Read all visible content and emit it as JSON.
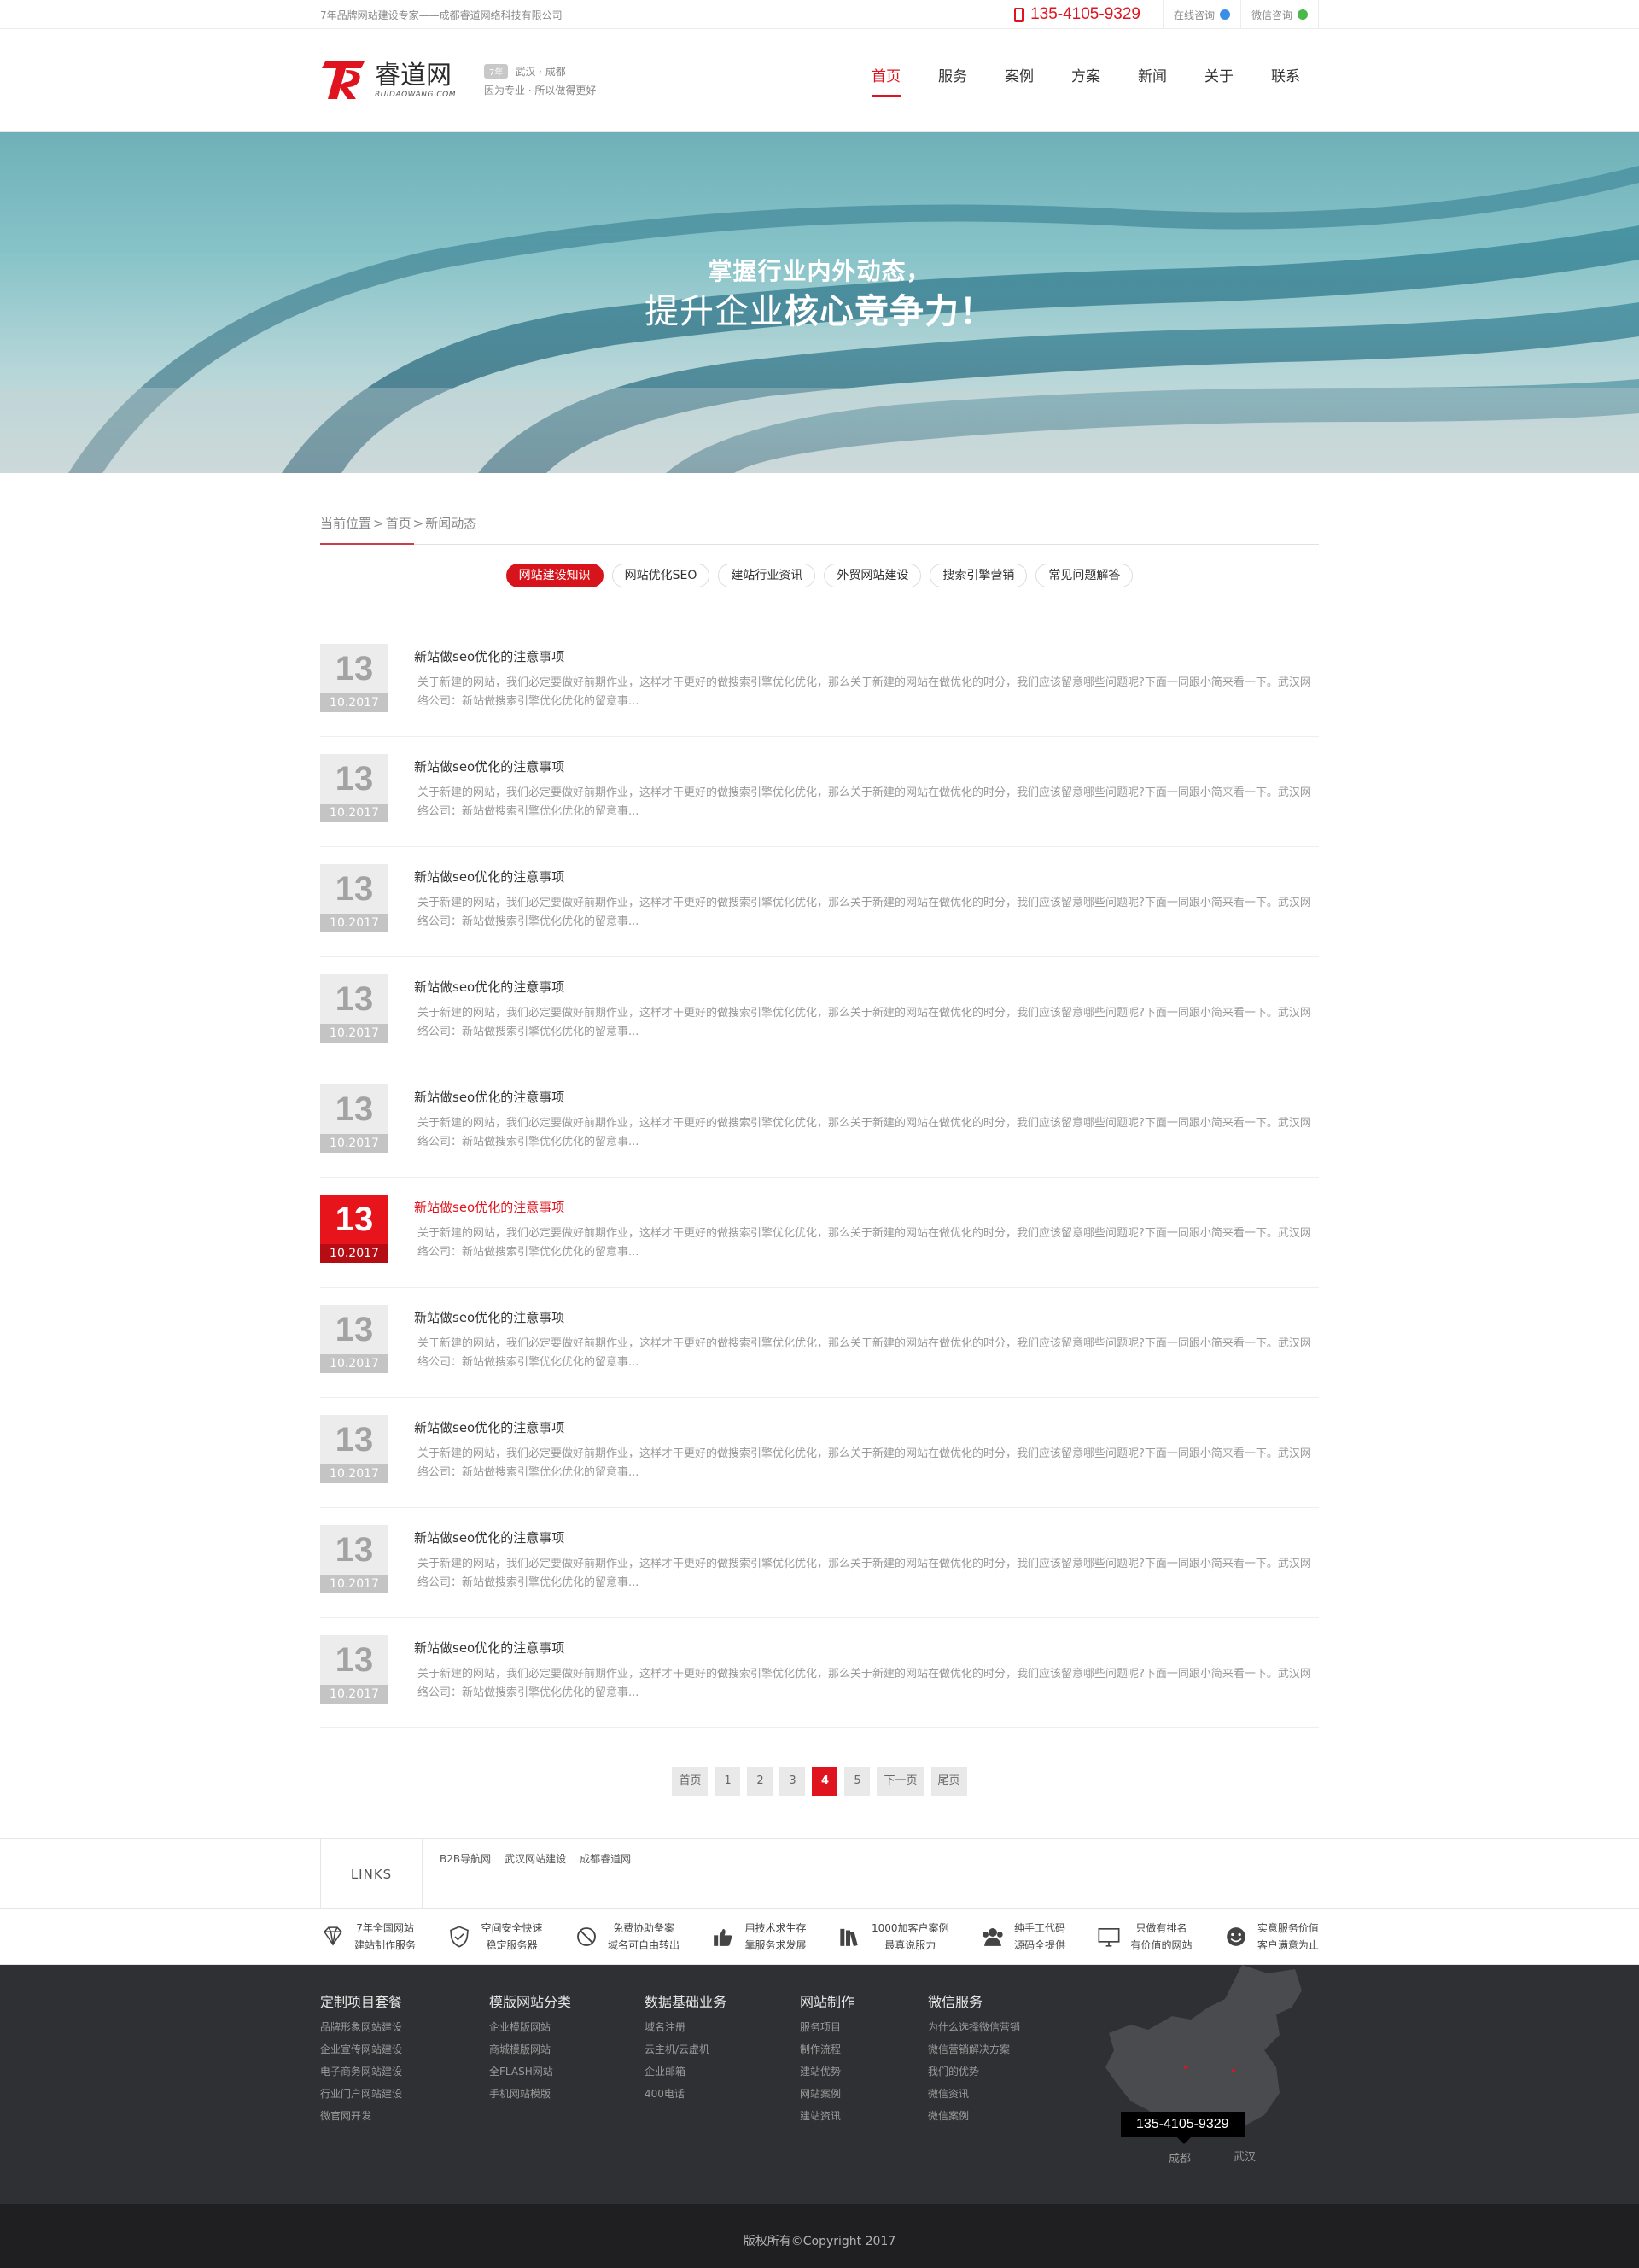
{
  "topbar": {
    "slogan": "7年品牌网站建设专家——成都睿道网络科技有限公司",
    "phone": "135-4105-9329",
    "online_consult": "在线咨询",
    "wechat_consult": "微信咨询"
  },
  "header": {
    "logo_cn": "睿道网",
    "logo_en": "RUIDAOWANG.COM",
    "logo_badge": "7年",
    "logo_cities": "武汉 · 成都",
    "logo_tagline": "因为专业 · 所以做得更好",
    "nav": [
      "首页",
      "服务",
      "案例",
      "方案",
      "新闻",
      "关于",
      "联系"
    ],
    "nav_active": 0
  },
  "banner": {
    "line1": "掌握行业内外动态，",
    "line2_plain": "提升企业",
    "line2_bold": "核心竞争力！"
  },
  "breadcrumb": {
    "label": "当前位置",
    "items": [
      "首页",
      "新闻动态"
    ]
  },
  "tabs": [
    "网站建设知识",
    "网站优化SEO",
    "建站行业资讯",
    "外贸网站建设",
    "搜索引擎营销",
    "常见问题解答"
  ],
  "tab_active": 0,
  "news": [
    {
      "day": "13",
      "ym": "10.2017",
      "title": "新站做seo优化的注意事项",
      "desc": "关于新建的网站，我们必定要做好前期作业，这样才干更好的做搜索引擎优化优化，那么关于新建的网站在做优化的时分，我们应该留意哪些问题呢?下面一同跟小简来看一下。武汉网络公司：新站做搜索引擎优化优化的留意事..."
    },
    {
      "day": "13",
      "ym": "10.2017",
      "title": "新站做seo优化的注意事项",
      "desc": "关于新建的网站，我们必定要做好前期作业，这样才干更好的做搜索引擎优化优化，那么关于新建的网站在做优化的时分，我们应该留意哪些问题呢?下面一同跟小简来看一下。武汉网络公司：新站做搜索引擎优化优化的留意事..."
    },
    {
      "day": "13",
      "ym": "10.2017",
      "title": "新站做seo优化的注意事项",
      "desc": "关于新建的网站，我们必定要做好前期作业，这样才干更好的做搜索引擎优化优化，那么关于新建的网站在做优化的时分，我们应该留意哪些问题呢?下面一同跟小简来看一下。武汉网络公司：新站做搜索引擎优化优化的留意事..."
    },
    {
      "day": "13",
      "ym": "10.2017",
      "title": "新站做seo优化的注意事项",
      "desc": "关于新建的网站，我们必定要做好前期作业，这样才干更好的做搜索引擎优化优化，那么关于新建的网站在做优化的时分，我们应该留意哪些问题呢?下面一同跟小简来看一下。武汉网络公司：新站做搜索引擎优化优化的留意事..."
    },
    {
      "day": "13",
      "ym": "10.2017",
      "title": "新站做seo优化的注意事项",
      "desc": "关于新建的网站，我们必定要做好前期作业，这样才干更好的做搜索引擎优化优化，那么关于新建的网站在做优化的时分，我们应该留意哪些问题呢?下面一同跟小简来看一下。武汉网络公司：新站做搜索引擎优化优化的留意事..."
    },
    {
      "day": "13",
      "ym": "10.2017",
      "title": "新站做seo优化的注意事项",
      "desc": "关于新建的网站，我们必定要做好前期作业，这样才干更好的做搜索引擎优化优化，那么关于新建的网站在做优化的时分，我们应该留意哪些问题呢?下面一同跟小简来看一下。武汉网络公司：新站做搜索引擎优化优化的留意事...",
      "highlight": true
    },
    {
      "day": "13",
      "ym": "10.2017",
      "title": "新站做seo优化的注意事项",
      "desc": "关于新建的网站，我们必定要做好前期作业，这样才干更好的做搜索引擎优化优化，那么关于新建的网站在做优化的时分，我们应该留意哪些问题呢?下面一同跟小简来看一下。武汉网络公司：新站做搜索引擎优化优化的留意事..."
    },
    {
      "day": "13",
      "ym": "10.2017",
      "title": "新站做seo优化的注意事项",
      "desc": "关于新建的网站，我们必定要做好前期作业，这样才干更好的做搜索引擎优化优化，那么关于新建的网站在做优化的时分，我们应该留意哪些问题呢?下面一同跟小简来看一下。武汉网络公司：新站做搜索引擎优化优化的留意事..."
    },
    {
      "day": "13",
      "ym": "10.2017",
      "title": "新站做seo优化的注意事项",
      "desc": "关于新建的网站，我们必定要做好前期作业，这样才干更好的做搜索引擎优化优化，那么关于新建的网站在做优化的时分，我们应该留意哪些问题呢?下面一同跟小简来看一下。武汉网络公司：新站做搜索引擎优化优化的留意事..."
    },
    {
      "day": "13",
      "ym": "10.2017",
      "title": "新站做seo优化的注意事项",
      "desc": "关于新建的网站，我们必定要做好前期作业，这样才干更好的做搜索引擎优化优化，那么关于新建的网站在做优化的时分，我们应该留意哪些问题呢?下面一同跟小简来看一下。武汉网络公司：新站做搜索引擎优化优化的留意事..."
    }
  ],
  "pager": {
    "items": [
      "首页",
      "1",
      "2",
      "3",
      "4",
      "5",
      "下一页",
      "尾页"
    ],
    "current": "4"
  },
  "links": {
    "label": "LINKS",
    "items": [
      "B2B导航网",
      "武汉网站建设",
      "成都睿道网"
    ]
  },
  "features": [
    {
      "icon": "diamond-icon",
      "l1": "7年全国网站",
      "l2": "建站制作服务"
    },
    {
      "icon": "shield-icon",
      "l1": "空间安全快速",
      "l2": "稳定服务器"
    },
    {
      "icon": "ban-icon",
      "l1": "免费协助备案",
      "l2": "域名可自由转出"
    },
    {
      "icon": "thumbs-up-icon",
      "l1": "用技术求生存",
      "l2": "靠服务求发展"
    },
    {
      "icon": "books-icon",
      "l1": "1000加客户案例",
      "l2": "最真说服力"
    },
    {
      "icon": "users-icon",
      "l1": "纯手工代码",
      "l2": "源码全提供"
    },
    {
      "icon": "monitor-icon",
      "l1": "只做有排名",
      "l2": "有价值的网站"
    },
    {
      "icon": "smile-icon",
      "l1": "实意服务价值",
      "l2": "客户满意为止"
    }
  ],
  "footer_cols": [
    {
      "title": "定制项目套餐",
      "items": [
        "品牌形象网站建设",
        "企业宣传网站建设",
        "电子商务网站建设",
        "行业门户网站建设",
        "微官网开发"
      ]
    },
    {
      "title": "模版网站分类",
      "items": [
        "企业模版网站",
        "商城模版网站",
        "全FLASH网站",
        "手机网站模版"
      ]
    },
    {
      "title": "数据基础业务",
      "items": [
        "域名注册",
        "云主机/云虚机",
        "企业邮箱",
        "400电话"
      ]
    },
    {
      "title": "网站制作",
      "items": [
        "服务项目",
        "制作流程",
        "建站优势",
        "网站案例",
        "建站资讯"
      ]
    },
    {
      "title": "微信服务",
      "items": [
        "为什么选择微信营销",
        "微信营销解决方案",
        "我们的优势",
        "微信资讯",
        "微信案例"
      ]
    }
  ],
  "map": {
    "phone": "135-4105-9329",
    "city1": "成都",
    "city2": "武汉"
  },
  "copyright": "版权所有©Copyright 2017",
  "colors": {
    "accent": "#e0141e",
    "footer_bg": "#2f3033",
    "copy_bg": "#1f1f21"
  }
}
